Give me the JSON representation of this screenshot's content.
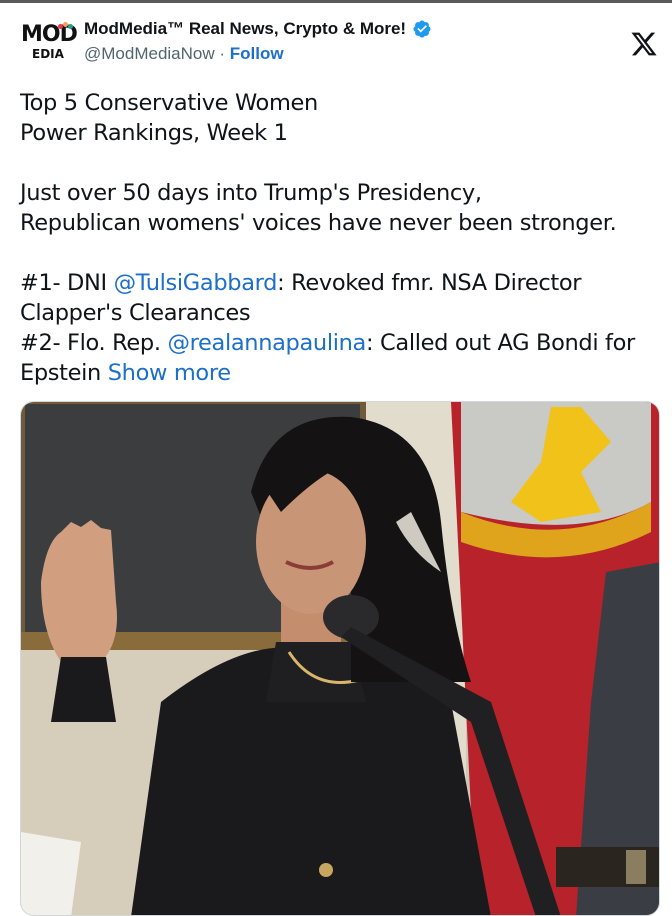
{
  "account": {
    "display_name": "ModMedia™ Real News, Crypto & More!",
    "handle": "@ModMediaNow",
    "separator": " · ",
    "follow_label": "Follow",
    "logo_top": "MOD",
    "logo_bottom": "EDIA",
    "verified_icon": "verified-badge-icon"
  },
  "platform_icon": "x-logo-icon",
  "tweet": {
    "line1": "Top 5 Conservative Women",
    "line2": "Power Rankings, Week 1",
    "para2_line1": "Just over 50 days into Trump's Presidency,",
    "para2_line2": "Republican womens' voices have never been stronger.",
    "item1_prefix": "#1- DNI ",
    "item1_mention": "@TulsiGabbard",
    "item1_suffix": ": Revoked fmr. NSA Director",
    "item1_line2": "Clapper's Clearances",
    "item2_prefix": "#2- Flo. Rep. ",
    "item2_mention": "@realannapaulina",
    "item2_suffix": ": Called out AG Bondi for",
    "item2_line2": "Epstein ",
    "show_more": "Show more"
  },
  "media": {
    "kind": "photo",
    "subject": "woman in black suit raising right hand at a microphone"
  },
  "colors": {
    "link": "#1d6fc9",
    "verified": "#1d9bf0",
    "text": "#0f1419",
    "muted": "#536471"
  }
}
